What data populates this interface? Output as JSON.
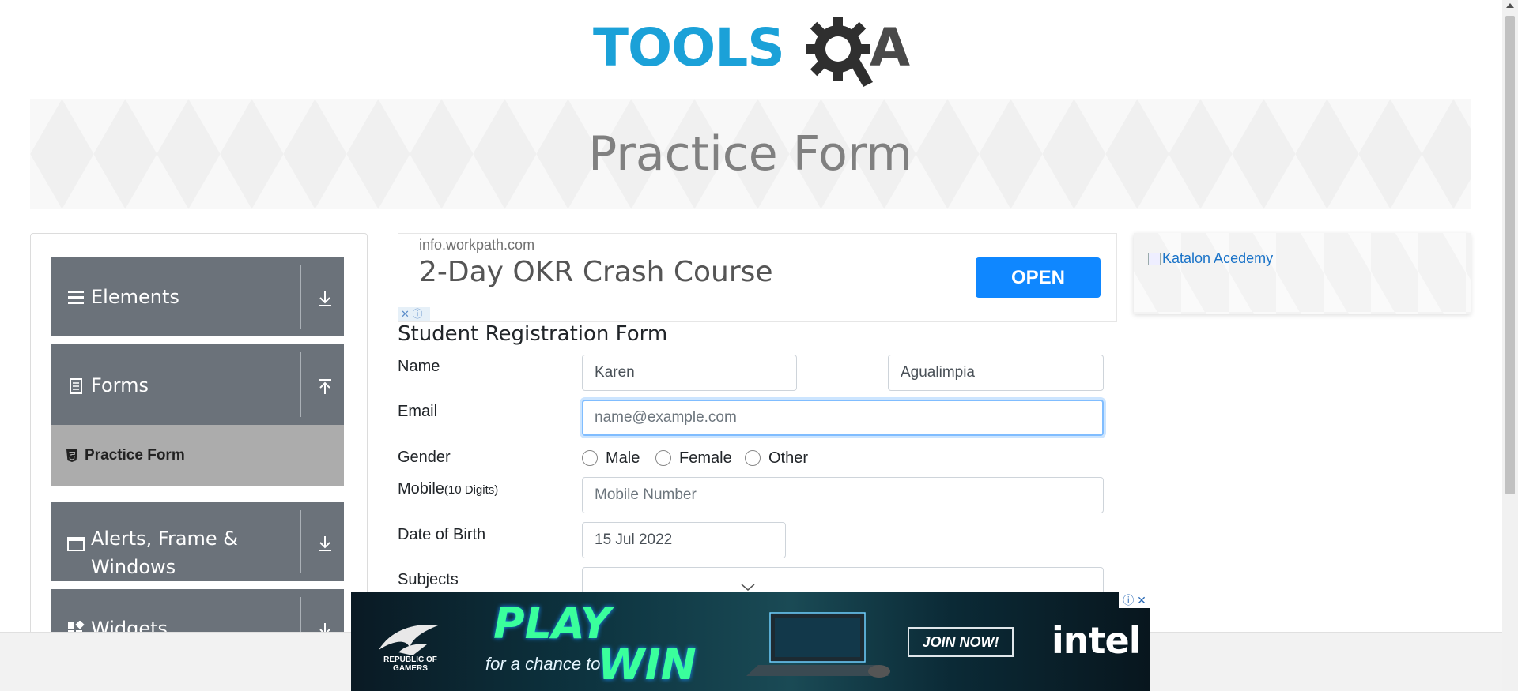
{
  "header": {
    "logo_text": "TOOLS",
    "logo_a": "A",
    "logo_alt": "TOOLSQA",
    "page_title": "Practice Form"
  },
  "sidebar": {
    "groups": [
      {
        "label": "Elements",
        "icon": "hamburger-icon",
        "expanded": false
      },
      {
        "label": "Forms",
        "icon": "document-icon",
        "expanded": true
      },
      {
        "label_line1": "Alerts, Frame &",
        "label_line2": "Windows",
        "icon": "window-icon",
        "expanded": false
      },
      {
        "label": "Widgets",
        "icon": "widgets-icon",
        "expanded": false
      }
    ],
    "active_item": "Practice Form"
  },
  "ad_top": {
    "domain": "info.workpath.com",
    "headline": "2-Day OKR Crash Course",
    "button": "OPEN"
  },
  "ad_right": {
    "alt_text": "Katalon Acedemy"
  },
  "form": {
    "title": "Student Registration Form",
    "name_label": "Name",
    "first_name": "Karen",
    "last_name": "Agualimpia",
    "email_label": "Email",
    "email_placeholder": "name@example.com",
    "gender_label": "Gender",
    "gender_options": [
      "Male",
      "Female",
      "Other"
    ],
    "mobile_label": "Mobile",
    "mobile_hint": "(10 Digits)",
    "mobile_placeholder": "Mobile Number",
    "dob_label": "Date of Birth",
    "dob_value": "15 Jul 2022",
    "subjects_label": "Subjects"
  },
  "ad_bottom": {
    "brand_sub": "REPUBLIC OF GAMERS",
    "play": "PLAY",
    "chance": "for a chance to",
    "win": "WIN",
    "button": "JOIN NOW!",
    "sponsor": "intel",
    "adchoices": "ⓘ ✕"
  },
  "colors": {
    "accent": "#0f87ff",
    "sidebar_group": "#6b727a",
    "logo_blue": "#1ba1d8"
  }
}
